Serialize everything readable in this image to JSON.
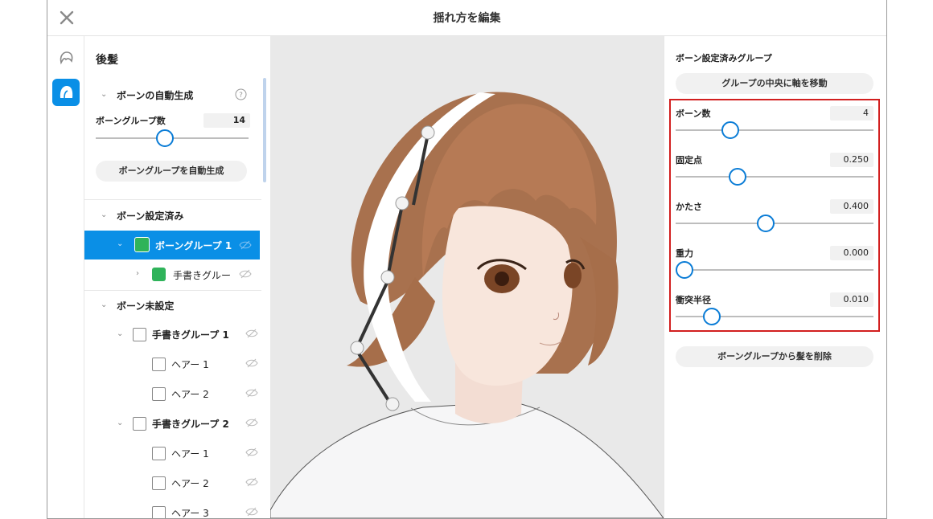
{
  "window": {
    "title": "揺れ方を編集"
  },
  "rail": {
    "items": [
      {
        "icon": "hair-front-icon",
        "active": false
      },
      {
        "icon": "hair-back-icon",
        "active": true
      }
    ]
  },
  "left_panel": {
    "section_title": "後髪",
    "auto_gen": {
      "header": "ボーンの自動生成",
      "group_count_label": "ボーングループ数",
      "group_count_value": "14",
      "group_count_level": 0.45,
      "button": "ボーングループを自動生成"
    },
    "configured": {
      "header": "ボーン設定済み",
      "selected_group": "ボーングループ 1",
      "child": "手書きグルー"
    },
    "unconfigured": {
      "header": "ボーン未設定",
      "items": [
        {
          "label": "手書きグループ 1",
          "level": 1
        },
        {
          "label": "ヘアー 1",
          "level": 2
        },
        {
          "label": "ヘアー 2",
          "level": 2
        },
        {
          "label": "手書きグループ 2",
          "level": 1
        },
        {
          "label": "ヘアー 1",
          "level": 2
        },
        {
          "label": "ヘアー 2",
          "level": 2
        },
        {
          "label": "ヘアー 3",
          "level": 2
        }
      ]
    }
  },
  "right_panel": {
    "header": "ボーン設定済みグループ",
    "center_button": "グループの中央に軸を移動",
    "fields": [
      {
        "label": "ボーン数",
        "value": "4",
        "level": 0.23
      },
      {
        "label": "固定点",
        "value": "0.250",
        "level": 0.27
      },
      {
        "label": "かたさ",
        "value": "0.400",
        "level": 0.41
      },
      {
        "label": "重力",
        "value": "0.000",
        "level": 0.0
      },
      {
        "label": "衝突半径",
        "value": "0.010",
        "level": 0.14
      }
    ],
    "remove_button": "ボーングループから髪を削除"
  },
  "colors": {
    "accent": "#0a8fe6",
    "group_color": "#2fb35a",
    "highlight_box": "#d21f1f"
  }
}
